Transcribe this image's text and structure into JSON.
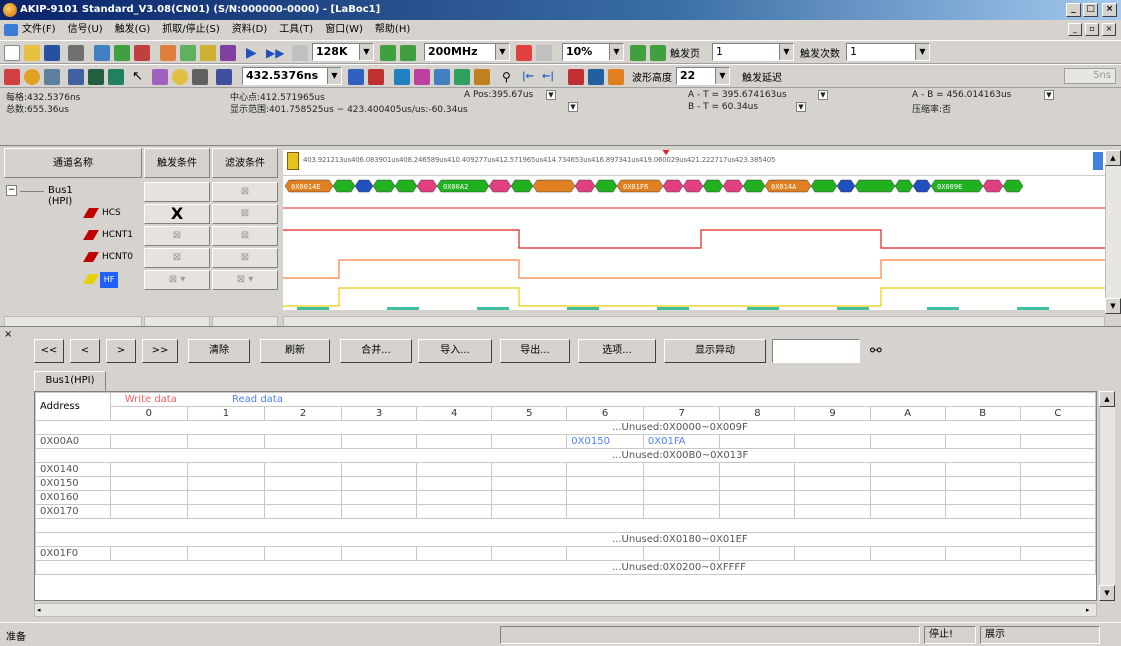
{
  "window": {
    "title": "AKIP-9101 Standard_V3.08(CN01) (S/N:000000-0000) - [LaBoc1]"
  },
  "menu": [
    "文件(F)",
    "信号(U)",
    "触发(G)",
    "抓取/停止(S)",
    "资料(D)",
    "工具(T)",
    "窗口(W)",
    "帮助(H)"
  ],
  "toolbar1": {
    "memory": "128K",
    "frequency": "200MHz",
    "percent": "10%",
    "trigger_page_label": "触发页",
    "trigger_page_value": "1",
    "trigger_count_label": "触发次数",
    "trigger_count_value": "1"
  },
  "toolbar2": {
    "position": "432.5376ns",
    "waveform_height_label": "波形高度",
    "waveform_height_value": "22",
    "trigger_delay_label": "触发延迟",
    "trigger_delay_value": "5ns"
  },
  "info": {
    "scale": "每格:432.5376ns",
    "total": "总数:655.36us",
    "center": "中心点:412.571965us",
    "range": "显示范围:401.758525us ~ 423.400405us/us:-60.34us",
    "a_pos": "A Pos:395.67us",
    "a_minus_t": "A - T = 395.674163us",
    "b_minus_t": "B - T = 60.34us",
    "a_minus_b": "A - B = 456.014163us",
    "compression": "压缩率:否"
  },
  "signal_headers": {
    "name": "通道名称",
    "trigger": "触发条件",
    "filter": "滤波条件"
  },
  "signals": [
    {
      "name": "Bus1 (HPI)",
      "color": "#c00000"
    },
    {
      "name": "HCS",
      "color": "#c00000",
      "trigger": "X"
    },
    {
      "name": "HCNT1",
      "color": "#c00000"
    },
    {
      "name": "HCNT0",
      "color": "#c00000"
    },
    {
      "name": "HF",
      "color": "#2060ff"
    }
  ],
  "ruler_text": "403.921213us406.083901us408.246589us410.409277us412.571965us414.734653us416.897341us419.060029us421.222717us423.385405",
  "bus_labels": [
    "0X0014E",
    "0X00A2",
    "0X01F6",
    "0X014A",
    "0X009E"
  ],
  "buttons": {
    "first": "<<",
    "prev": "<",
    "next": ">",
    "last": ">>",
    "clear": "清除",
    "refresh": "刷新",
    "merge": "合并...",
    "import": "导入...",
    "export": "导出...",
    "options": "选项...",
    "show_diff": "显示异动"
  },
  "tab_label": "Bus1(HPI)",
  "grid": {
    "address_header": "Address",
    "write_label": "Write data",
    "read_label": "Read data",
    "columns": [
      "0",
      "1",
      "2",
      "3",
      "4",
      "5",
      "6",
      "7",
      "8",
      "9",
      "A",
      "B",
      "C"
    ],
    "rows": [
      {
        "type": "unused",
        "text": "...Unused:0X0000~0X009F"
      },
      {
        "type": "data",
        "addr": "0X00A0",
        "cells": {
          "6": "0X0150",
          "7": "0X01FA"
        }
      },
      {
        "type": "unused",
        "text": "...Unused:0X00B0~0X013F"
      },
      {
        "type": "data",
        "addr": "0X0140",
        "cells": {}
      },
      {
        "type": "data",
        "addr": "0X0150",
        "cells": {}
      },
      {
        "type": "data",
        "addr": "0X0160",
        "cells": {}
      },
      {
        "type": "data",
        "addr": "0X0170",
        "cells": {}
      },
      {
        "type": "blank"
      },
      {
        "type": "unused",
        "text": "...Unused:0X0180~0X01EF"
      },
      {
        "type": "data",
        "addr": "0X01F0",
        "cells": {}
      },
      {
        "type": "unused",
        "text": "...Unused:0X0200~0XFFFF"
      }
    ]
  },
  "status": {
    "ready": "准备",
    "stop": "停止!",
    "display": "展示"
  },
  "colors": {
    "bus_green": "#20b020",
    "bus_orange": "#e08020",
    "bus_pink": "#e04080",
    "bus_blue": "#2050c0",
    "wave_red": "#e02020",
    "wave_orange": "#ff8040",
    "wave_yellow": "#e8d000",
    "wave_teal": "#40c0a0"
  }
}
